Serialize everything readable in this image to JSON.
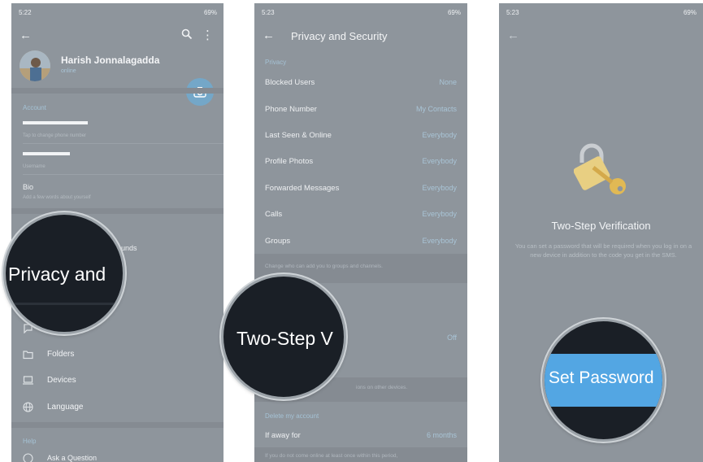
{
  "phone1": {
    "status": {
      "time": "5:22",
      "right": "69%"
    },
    "profile": {
      "name": "Harish Jonnalagadda",
      "status": "online"
    },
    "account": {
      "header": "Account",
      "phone_hint": "Tap to change phone number",
      "username_hint": "Username",
      "bio_label": "Bio",
      "bio_hint": "Add a few words about yourself"
    },
    "partial_item": "unds",
    "menu": [
      {
        "label": "Folders",
        "icon": "folder-icon"
      },
      {
        "label": "Devices",
        "icon": "devices-icon"
      },
      {
        "label": "Language",
        "icon": "globe-icon"
      }
    ],
    "help": {
      "header": "Help",
      "item": "Ask a Question"
    },
    "magnifier_text": "Privacy and"
  },
  "phone2": {
    "status": {
      "time": "5:23",
      "right": "69%"
    },
    "title": "Privacy and Security",
    "section": "Privacy",
    "rows": [
      {
        "label": "Blocked Users",
        "value": "None"
      },
      {
        "label": "Phone Number",
        "value": "My Contacts"
      },
      {
        "label": "Last Seen & Online",
        "value": "Everybody"
      },
      {
        "label": "Profile Photos",
        "value": "Everybody"
      },
      {
        "label": "Forwarded Messages",
        "value": "Everybody"
      },
      {
        "label": "Calls",
        "value": "Everybody"
      },
      {
        "label": "Groups",
        "value": "Everybody"
      }
    ],
    "groups_hint": "Change who can add you to groups and channels.",
    "two_step_value": "Off",
    "sessions_hint": "ions on other devices.",
    "delete_header": "Delete my account",
    "away_label": "If away for",
    "away_value": "6 months",
    "away_hint": "If you do not come online at least once within this period,",
    "magnifier_text": "Two-Step V"
  },
  "phone3": {
    "status": {
      "time": "5:23",
      "right": "69%"
    },
    "title": "Two-Step Verification",
    "description": "You can set a password that will be required when you log in on a new device in addition to the code you get in the SMS.",
    "button": "Set Password"
  },
  "colors": {
    "accent": "#53a6e3",
    "overlay": "#8e959c",
    "value_blue": "#a9c4d6"
  }
}
